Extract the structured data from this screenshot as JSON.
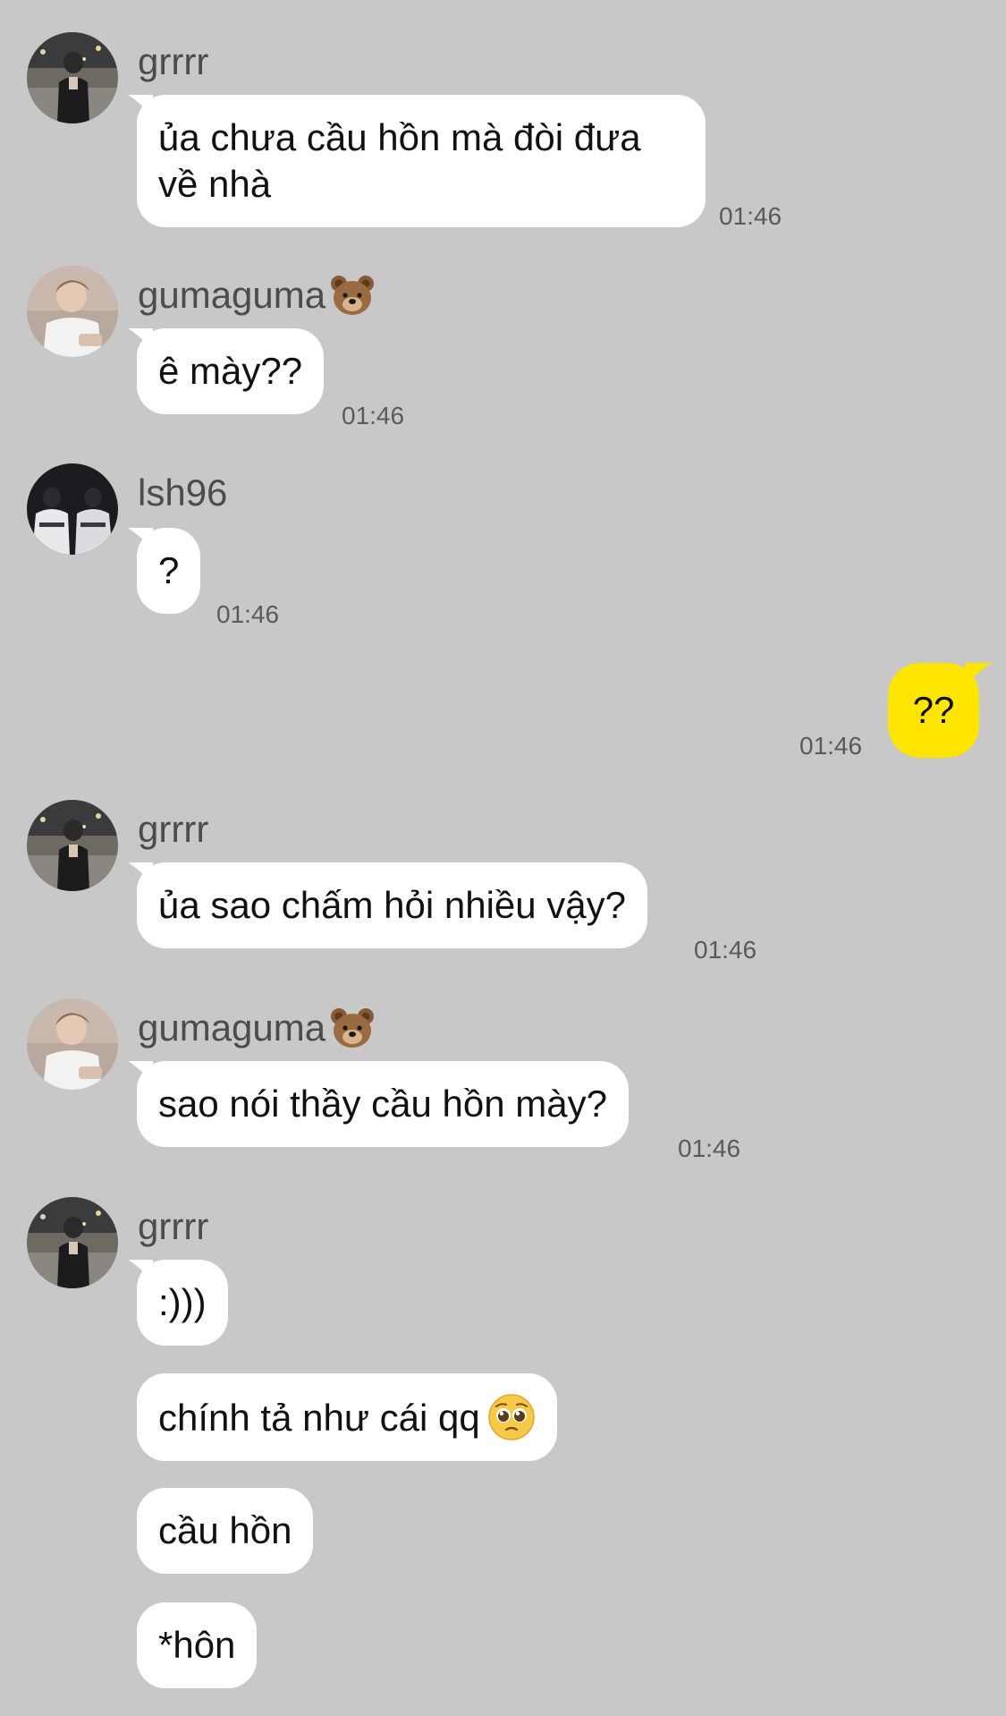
{
  "messages": [
    {
      "sender": "grrrr",
      "text": "ủa chưa cầu hồn mà đòi đưa về nhà",
      "time": "01:46"
    },
    {
      "sender": "gumaguma",
      "sender_emoji": "bear-face-emoji",
      "text": "ê mày??",
      "time": "01:46"
    },
    {
      "sender": "lsh96",
      "text": "?",
      "time": "01:46"
    },
    {
      "sender": "me",
      "text": "??",
      "time": "01:46"
    },
    {
      "sender": "grrrr",
      "text": "ủa sao chấm hỏi nhiều vậy?",
      "time": "01:46"
    },
    {
      "sender": "gumaguma",
      "sender_emoji": "bear-face-emoji",
      "text": "sao nói thầy cầu hồn mày?",
      "time": "01:46"
    },
    {
      "sender": "grrrr",
      "texts": [
        ":)))",
        "chính tả như cái qq",
        "cầu hồn",
        "*hôn"
      ],
      "inline_emoji": "pleading-face-emoji"
    }
  ],
  "colors": {
    "background": "#c8c8c8",
    "incoming_bubble": "#ffffff",
    "outgoing_bubble": "#fee500",
    "sender_text": "#4c4c4c",
    "time_text": "#5a5a5a"
  }
}
